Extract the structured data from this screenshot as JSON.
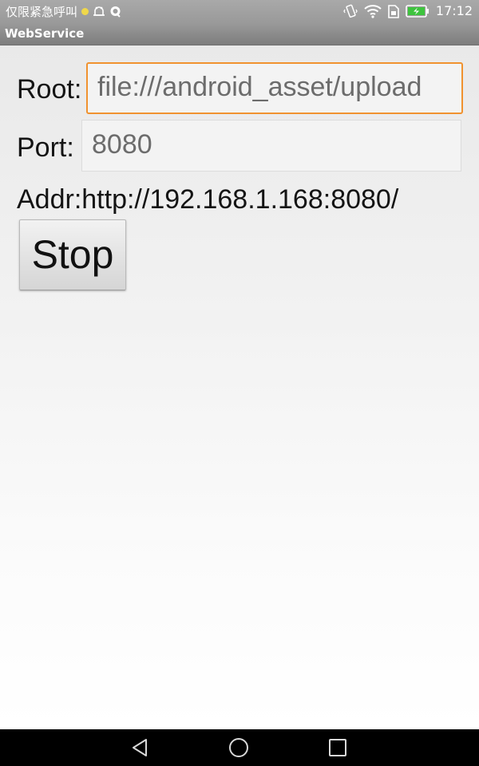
{
  "status_bar": {
    "notification_text": "仅限紧急呼叫",
    "time": "17:12",
    "icons": [
      "yellow-dot-icon",
      "android-debug-icon",
      "qq-icon",
      "vibrate-icon",
      "wifi-icon",
      "sim-icon",
      "battery-charging-icon"
    ],
    "colors": {
      "background": "#a0a0a0",
      "dot": "#f0d84a",
      "battery": "#3ec33e"
    }
  },
  "app": {
    "title": "WebService"
  },
  "form": {
    "root_label": "Root:",
    "root_value": "file:///android_asset/upload",
    "port_label": "Port:",
    "port_value": "8080",
    "addr_text": "Addr:http://192.168.1.168:8080/",
    "stop_label": "Stop",
    "colors": {
      "focus_border": "#f0922f"
    }
  },
  "nav_bar": {
    "icons": [
      "back-icon",
      "home-icon",
      "recents-icon"
    ]
  }
}
